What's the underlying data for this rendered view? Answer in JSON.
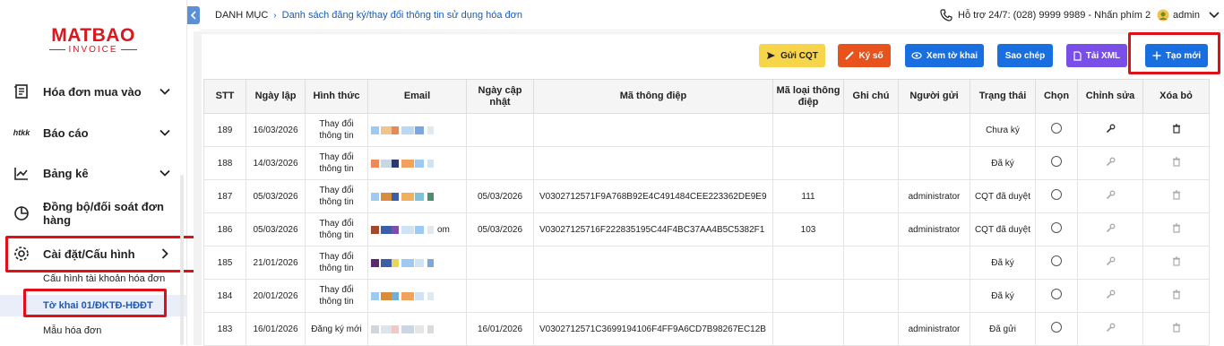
{
  "logo": {
    "brand": "MATBAO",
    "sub": "INVOICE"
  },
  "sidebar": {
    "items": [
      {
        "label": "Hóa đơn mua vào",
        "icon": "invoice-icon"
      },
      {
        "label": "Báo cáo",
        "icon": "htkk-icon",
        "icon_text": "htkk"
      },
      {
        "label": "Bảng kê",
        "icon": "chart-icon"
      },
      {
        "label": "Đồng bộ/đối soát đơn hàng",
        "icon": "pie-chart-icon"
      },
      {
        "label": "Cài đặt/Cấu hình",
        "icon": "gear-icon"
      }
    ],
    "subitems": [
      {
        "label": "Cấu hình tài khoản hóa đơn"
      },
      {
        "label": "Tờ khai 01/ĐKTĐ-HĐĐT",
        "active": true
      },
      {
        "label": "Mẫu hóa đơn"
      }
    ]
  },
  "topbar": {
    "breadcrumb_root": "DANH MỤC",
    "breadcrumb_sep": "›",
    "breadcrumb_current": "Danh sách đăng ký/thay đổi thông tin sử dụng hóa đơn",
    "support": "Hỗ trợ 24/7: (028) 9999 9989 - Nhấn phím 2",
    "user": "admin"
  },
  "toolbar": {
    "send_cqt": "Gửi CQT",
    "sign": "Ký số",
    "view": "Xem tờ khai",
    "copy": "Sao chép",
    "download_xml": "Tải XML",
    "create": "Tạo mới"
  },
  "table": {
    "headers": {
      "stt": "STT",
      "date": "Ngày lập",
      "type": "Hình thức",
      "email": "Email",
      "updated": "Ngày cập nhật",
      "msg": "Mã thông điệp",
      "msg_type": "Mã loại thông điệp",
      "note": "Ghi chú",
      "sender": "Người gửi",
      "status": "Trạng thái",
      "select": "Chọn",
      "edit": "Chỉnh sửa",
      "delete": "Xóa bỏ"
    },
    "rows": [
      {
        "stt": "189",
        "date": "16/03/2026",
        "type": "Thay đổi thông tin",
        "email_tail": "",
        "updated": "",
        "msg": "",
        "msg_type": "",
        "note": "",
        "sender": "",
        "status": "Chưa ký"
      },
      {
        "stt": "188",
        "date": "14/03/2026",
        "type": "Thay đổi thông tin",
        "email_tail": "",
        "updated": "",
        "msg": "",
        "msg_type": "",
        "note": "",
        "sender": "",
        "status": "Đã ký"
      },
      {
        "stt": "187",
        "date": "05/03/2026",
        "type": "Thay đổi thông tin",
        "email_tail": "",
        "updated": "05/03/2026",
        "msg": "V0302712571F9A768B92E4C491484CEE223362DE9E9",
        "msg_type": "111",
        "note": "",
        "sender": "administrator",
        "status": "CQT đã duyệt"
      },
      {
        "stt": "186",
        "date": "05/03/2026",
        "type": "Thay đổi thông tin",
        "email_tail": "om",
        "updated": "05/03/2026",
        "msg": "V03027125716F222835195C44F4BC37AA4B5C5382F1",
        "msg_type": "103",
        "note": "",
        "sender": "administrator",
        "status": "CQT đã duyệt"
      },
      {
        "stt": "185",
        "date": "21/01/2026",
        "type": "Thay đổi thông tin",
        "email_tail": "",
        "updated": "",
        "msg": "",
        "msg_type": "",
        "note": "",
        "sender": "",
        "status": "Đã ký"
      },
      {
        "stt": "184",
        "date": "20/01/2026",
        "type": "Thay đổi thông tin",
        "email_tail": "",
        "updated": "",
        "msg": "",
        "msg_type": "",
        "note": "",
        "sender": "",
        "status": "Đã ký"
      },
      {
        "stt": "183",
        "date": "16/01/2026",
        "type": "Đăng ký mới",
        "email_tail": "",
        "updated": "16/01/2026",
        "msg": "V0302712571C3699194106F4FF9A6CD7B98267EC12B",
        "msg_type": "",
        "note": "",
        "sender": "administrator",
        "status": "Đã gửi"
      }
    ]
  },
  "colors": {
    "accent": "#1a6fe0",
    "highlight": "#e0101a",
    "active_link": "#1a5bb8"
  }
}
